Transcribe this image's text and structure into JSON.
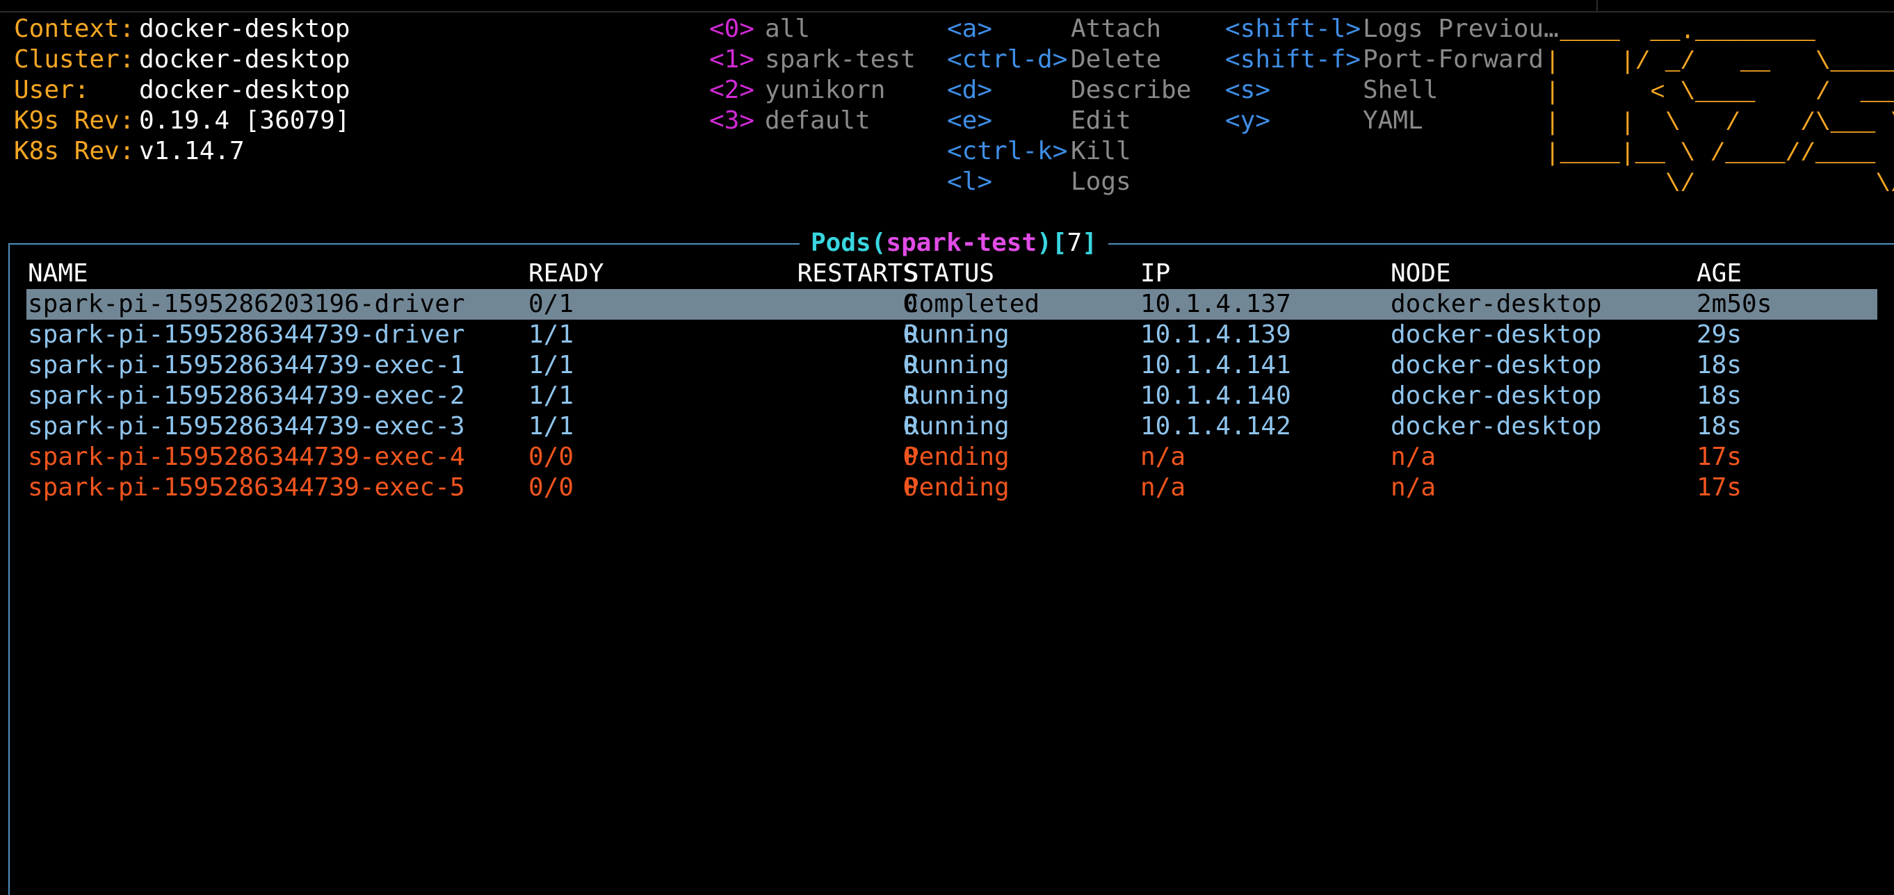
{
  "cluster_info": [
    {
      "label": "Context:",
      "value": "docker-desktop"
    },
    {
      "label": "Cluster:",
      "value": "docker-desktop"
    },
    {
      "label": "User:",
      "value": "docker-desktop"
    },
    {
      "label": "K9s Rev:",
      "value": "0.19.4 [36079]"
    },
    {
      "label": "K8s Rev:",
      "value": "v1.14.7"
    }
  ],
  "namespaces": [
    {
      "key": "<0>",
      "label": "all"
    },
    {
      "key": "<1>",
      "label": "spark-test"
    },
    {
      "key": "<2>",
      "label": "yunikorn"
    },
    {
      "key": "<3>",
      "label": "default"
    }
  ],
  "commands_col1": [
    {
      "key": "<a>",
      "label": "Attach"
    },
    {
      "key": "<ctrl-d>",
      "label": "Delete"
    },
    {
      "key": "<d>",
      "label": "Describe"
    },
    {
      "key": "<e>",
      "label": "Edit"
    },
    {
      "key": "<ctrl-k>",
      "label": "Kill"
    },
    {
      "key": "<l>",
      "label": "Logs"
    }
  ],
  "commands_col2": [
    {
      "key": "<shift-l>",
      "label": "Logs Previou…"
    },
    {
      "key": "<shift-f>",
      "label": "Port-Forward"
    },
    {
      "key": "<s>",
      "label": "Shell"
    },
    {
      "key": "<y>",
      "label": "YAML"
    }
  ],
  "logo_lines": [
    " ____  __.________",
    "|    |/ _/   __   \\______",
    "|      < \\____    /  ___/",
    "|    |  \\   /    /\\___ \\",
    "|____|__ \\ /____//____  >",
    "        \\/            \\/"
  ],
  "panel": {
    "title": "Pods",
    "namespace": "spark-test",
    "count": "7",
    "open_paren": "(",
    "close_paren": ")",
    "open_bracket": "[",
    "close_bracket": "]"
  },
  "columns": [
    "NAME",
    "READY",
    "RESTARTS",
    "STATUS",
    "IP",
    "NODE",
    "AGE"
  ],
  "pods": [
    {
      "name": "spark-pi-1595286203196-driver",
      "ready": "0/1",
      "restarts": "0",
      "status": "Completed",
      "ip": "10.1.4.137",
      "node": "docker-desktop",
      "age": "2m50s",
      "color": "#9fb0bd",
      "selected": true
    },
    {
      "name": "spark-pi-1595286344739-driver",
      "ready": "1/1",
      "restarts": "0",
      "status": "Running",
      "ip": "10.1.4.139",
      "node": "docker-desktop",
      "age": "29s",
      "color": "#8fc4ec"
    },
    {
      "name": "spark-pi-1595286344739-exec-1",
      "ready": "1/1",
      "restarts": "0",
      "status": "Running",
      "ip": "10.1.4.141",
      "node": "docker-desktop",
      "age": "18s",
      "color": "#8fc4ec"
    },
    {
      "name": "spark-pi-1595286344739-exec-2",
      "ready": "1/1",
      "restarts": "0",
      "status": "Running",
      "ip": "10.1.4.140",
      "node": "docker-desktop",
      "age": "18s",
      "color": "#8fc4ec"
    },
    {
      "name": "spark-pi-1595286344739-exec-3",
      "ready": "1/1",
      "restarts": "0",
      "status": "Running",
      "ip": "10.1.4.142",
      "node": "docker-desktop",
      "age": "18s",
      "color": "#8fc4ec"
    },
    {
      "name": "spark-pi-1595286344739-exec-4",
      "ready": "0/0",
      "restarts": "0",
      "status": "Pending",
      "ip": "n/a",
      "node": "n/a",
      "age": "17s",
      "color": "#f0551e"
    },
    {
      "name": "spark-pi-1595286344739-exec-5",
      "ready": "0/0",
      "restarts": "0",
      "status": "Pending",
      "ip": "n/a",
      "node": "n/a",
      "age": "17s",
      "color": "#f0551e"
    }
  ],
  "colors": {
    "label": "#f5a623",
    "ns_key": "#d22ad6",
    "cmd_key": "#3f8ee6",
    "frame": "#4f8fbf",
    "selected_bg": "#728796"
  }
}
